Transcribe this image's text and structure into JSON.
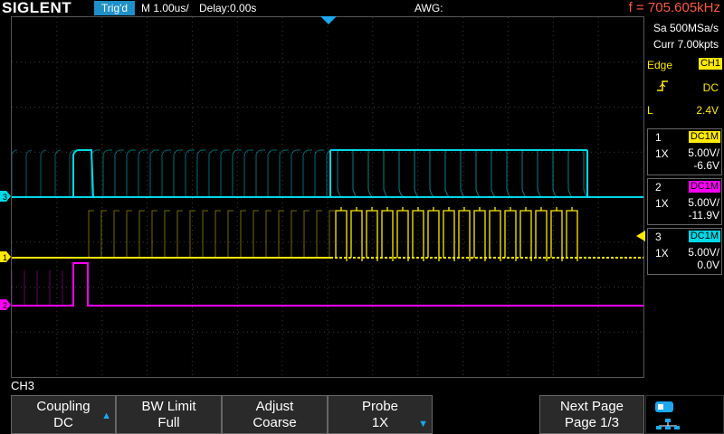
{
  "header": {
    "brand": "SIGLENT",
    "trigger_status": "Trig'd",
    "timebase": "M 1.00us/",
    "delay": "Delay:0.00s",
    "awg": "AWG:",
    "frequency": "f = 705.605kHz"
  },
  "acquisition": {
    "sample_rate": "Sa 500MSa/s",
    "memory": "Curr 7.00kpts"
  },
  "trigger": {
    "type": "Edge",
    "source": "CH1",
    "slope_icon": "rising-edge-icon",
    "coupling": "DC",
    "level_label": "L",
    "level": "2.4V"
  },
  "channels": [
    {
      "num": "1",
      "coupling": "DC1M",
      "probe": "1X",
      "scale": "5.00V/",
      "offset": "-6.6V",
      "color": "#ffea00",
      "text_color": "#000000"
    },
    {
      "num": "2",
      "coupling": "DC1M",
      "probe": "1X",
      "scale": "5.00V/",
      "offset": "-11.9V",
      "color": "#ff00ff",
      "text_color": "#000000"
    },
    {
      "num": "3",
      "coupling": "DC1M",
      "probe": "1X",
      "scale": "5.00V/",
      "offset": "0.0V",
      "color": "#00d8e8",
      "text_color": "#000000"
    }
  ],
  "markers": {
    "ch1": "1",
    "ch2": "2",
    "ch3": "3"
  },
  "menu": {
    "title": "CH3",
    "coupling_label": "Coupling",
    "coupling_value": "DC",
    "bw_label": "BW Limit",
    "bw_value": "Full",
    "adjust_label": "Adjust",
    "adjust_value": "Coarse",
    "probe_label": "Probe",
    "probe_value": "1X",
    "next_label": "Next Page",
    "next_value": "Page 1/3"
  },
  "colors": {
    "ch1": "#ffea00",
    "ch2": "#ff00ff",
    "ch3": "#00d8e8",
    "accent": "#1e90c8"
  }
}
